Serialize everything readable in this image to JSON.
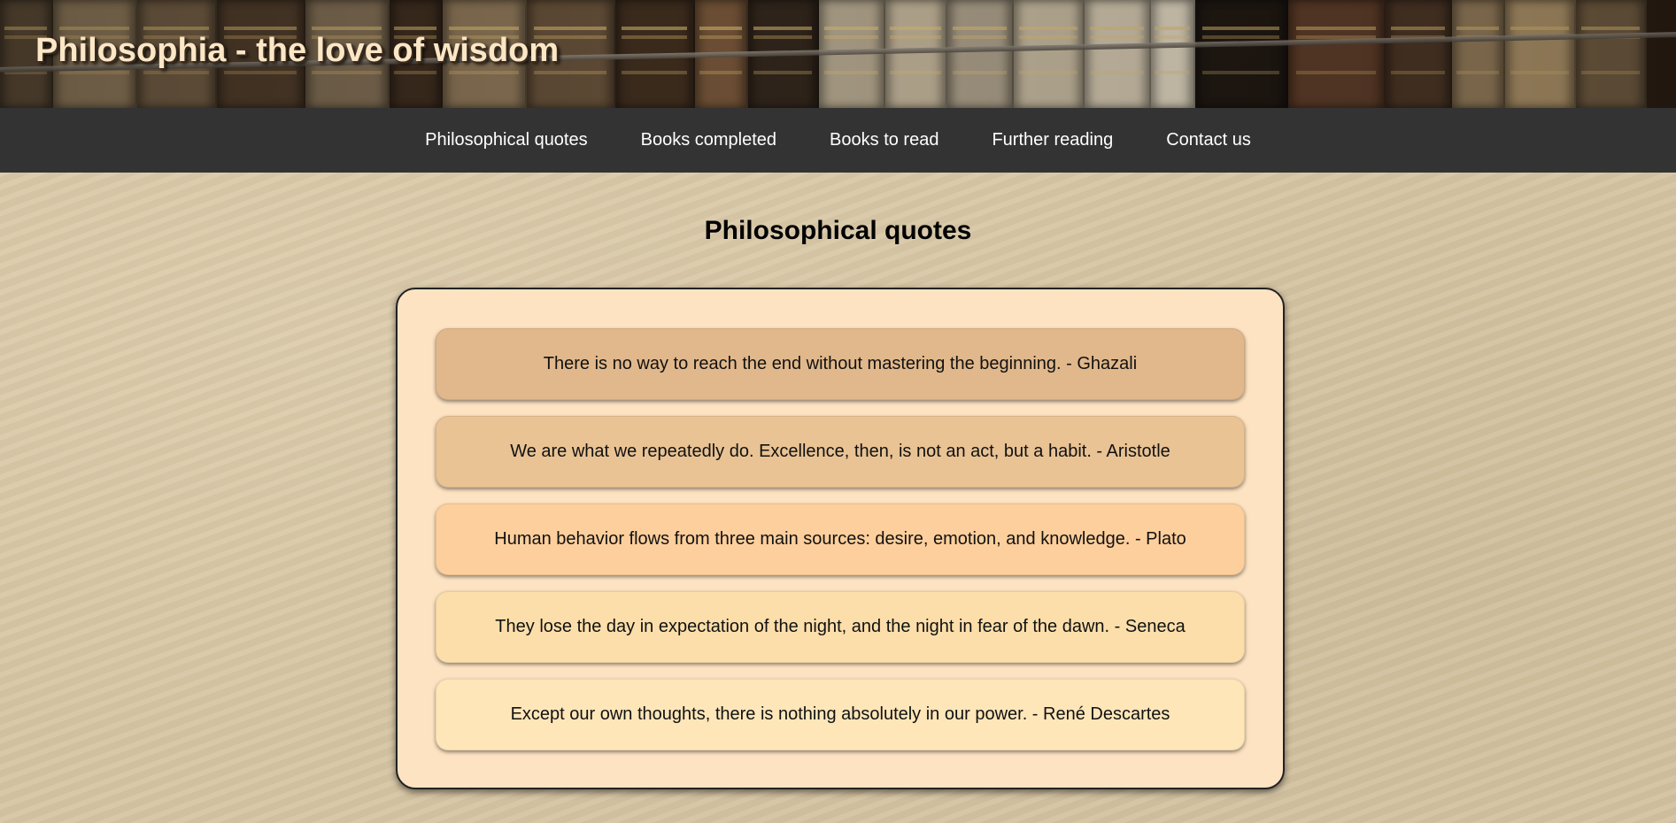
{
  "header": {
    "title": "Philosophia - the love of wisdom",
    "background": "bookshelf-image"
  },
  "nav": {
    "items": [
      {
        "label": "Philosophical quotes"
      },
      {
        "label": "Books completed"
      },
      {
        "label": "Books to read"
      },
      {
        "label": "Further reading"
      },
      {
        "label": "Contact us"
      }
    ]
  },
  "main": {
    "heading": "Philosophical quotes",
    "quotes": [
      {
        "text": "There is no way to reach the end without mastering the beginning. - Ghazali",
        "color": "#e1b88b"
      },
      {
        "text": "We are what we repeatedly do. Excellence, then, is not an act, but a habit. - Aristotle",
        "color": "#e9c394"
      },
      {
        "text": "Human behavior flows from three main sources: desire, emotion, and knowledge. - Plato",
        "color": "#fdcf9c"
      },
      {
        "text": "They lose the day in expectation of the night, and the night in fear of the dawn. - Seneca",
        "color": "#fcdeaa"
      },
      {
        "text": "Except our own thoughts, there is nothing absolutely in our power. - René Descartes",
        "color": "#fee6b9"
      }
    ]
  },
  "colors": {
    "nav_background": "#333333",
    "quote_box_background": "#fde3c2",
    "page_background": "#d6c5a3",
    "title_color": "#fbe6c6"
  }
}
